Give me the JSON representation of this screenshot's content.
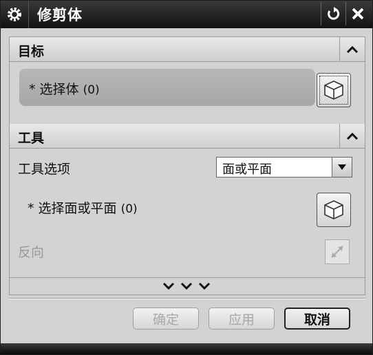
{
  "window": {
    "title": "修剪体"
  },
  "target_group": {
    "header": "目标",
    "select_body": {
      "asterisk": "*",
      "label": "选择体",
      "count": "(0)"
    }
  },
  "tool_group": {
    "header": "工具",
    "tool_option_label": "工具选项",
    "tool_option_value": "面或平面",
    "select_face": {
      "asterisk": "*",
      "label": "选择面或平面",
      "count": "(0)"
    },
    "reverse_label": "反向"
  },
  "buttons": {
    "ok": "确定",
    "apply": "应用",
    "cancel": "取消"
  }
}
